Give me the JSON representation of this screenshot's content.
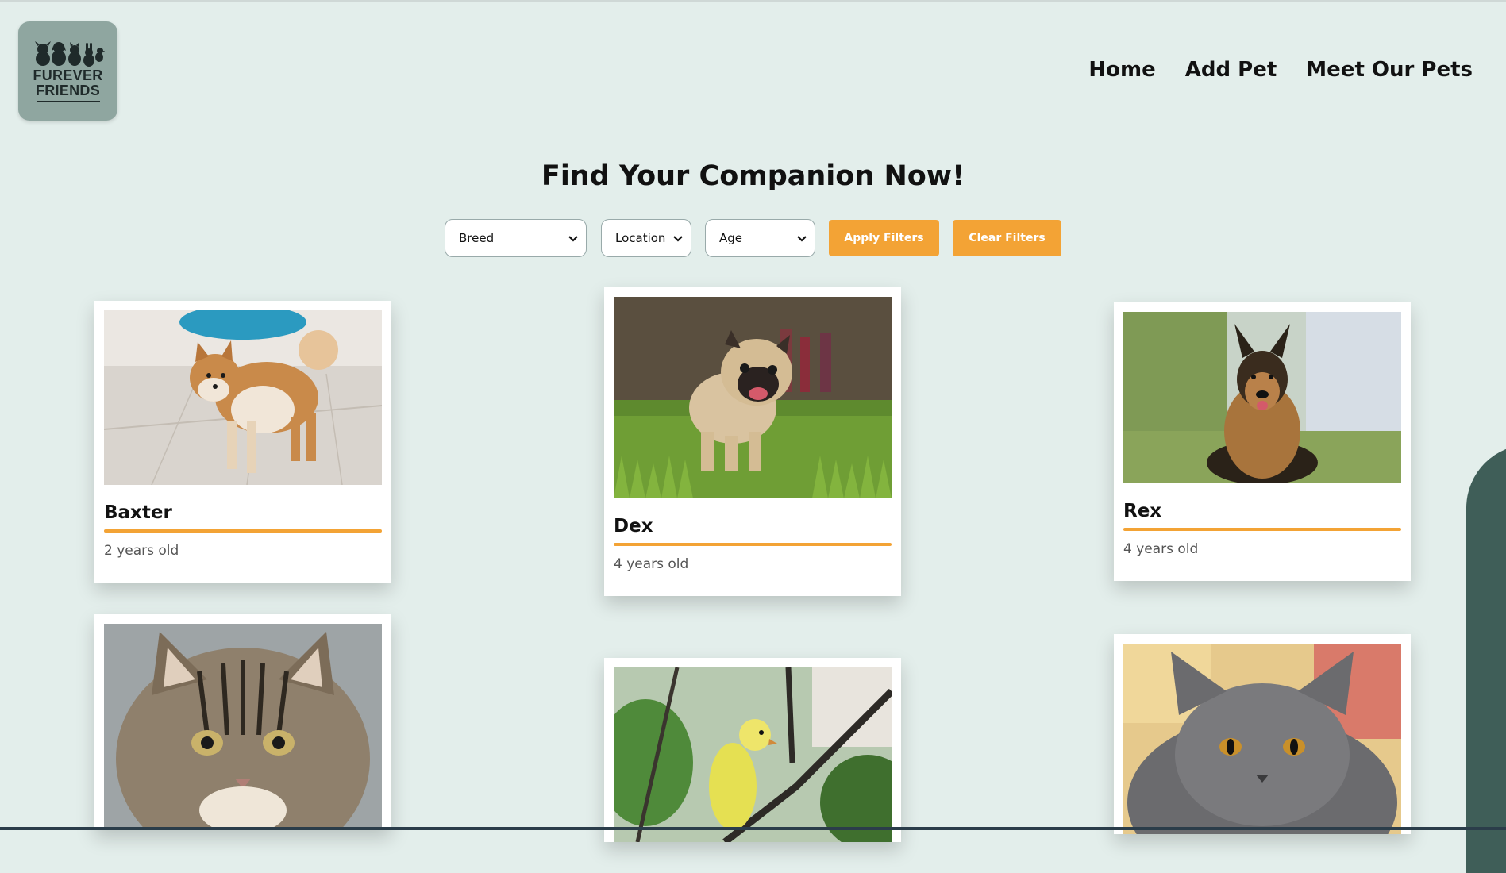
{
  "logo": {
    "line1": "FUREVER",
    "line2": "FRIENDS"
  },
  "nav": {
    "home": "Home",
    "add_pet": "Add Pet",
    "meet_pets": "Meet Our Pets"
  },
  "heading": "Find Your Companion Now!",
  "filters": {
    "breed": "Breed",
    "location": "Location",
    "age": "Age",
    "apply": "Apply Filters",
    "clear": "Clear Filters"
  },
  "pets": [
    {
      "name": "Baxter",
      "age": "2 years old",
      "image": "shiba-inu-dog-photo"
    },
    {
      "name": "Dex",
      "age": "4 years old",
      "image": "pug-dog-photo"
    },
    {
      "name": "Rex",
      "age": "4 years old",
      "image": "german-shepherd-dog-photo"
    },
    {
      "name": "",
      "age": "",
      "image": "maine-coon-cat-photo"
    },
    {
      "name": "",
      "age": "",
      "image": "yellow-parakeet-photo"
    },
    {
      "name": "",
      "age": "",
      "image": "british-shorthair-cat-photo"
    }
  ],
  "colors": {
    "background": "#e3eeeb",
    "accent": "#f3a335",
    "logo_bg": "#8fa6a0",
    "dark_teal": "#3f5e58"
  }
}
